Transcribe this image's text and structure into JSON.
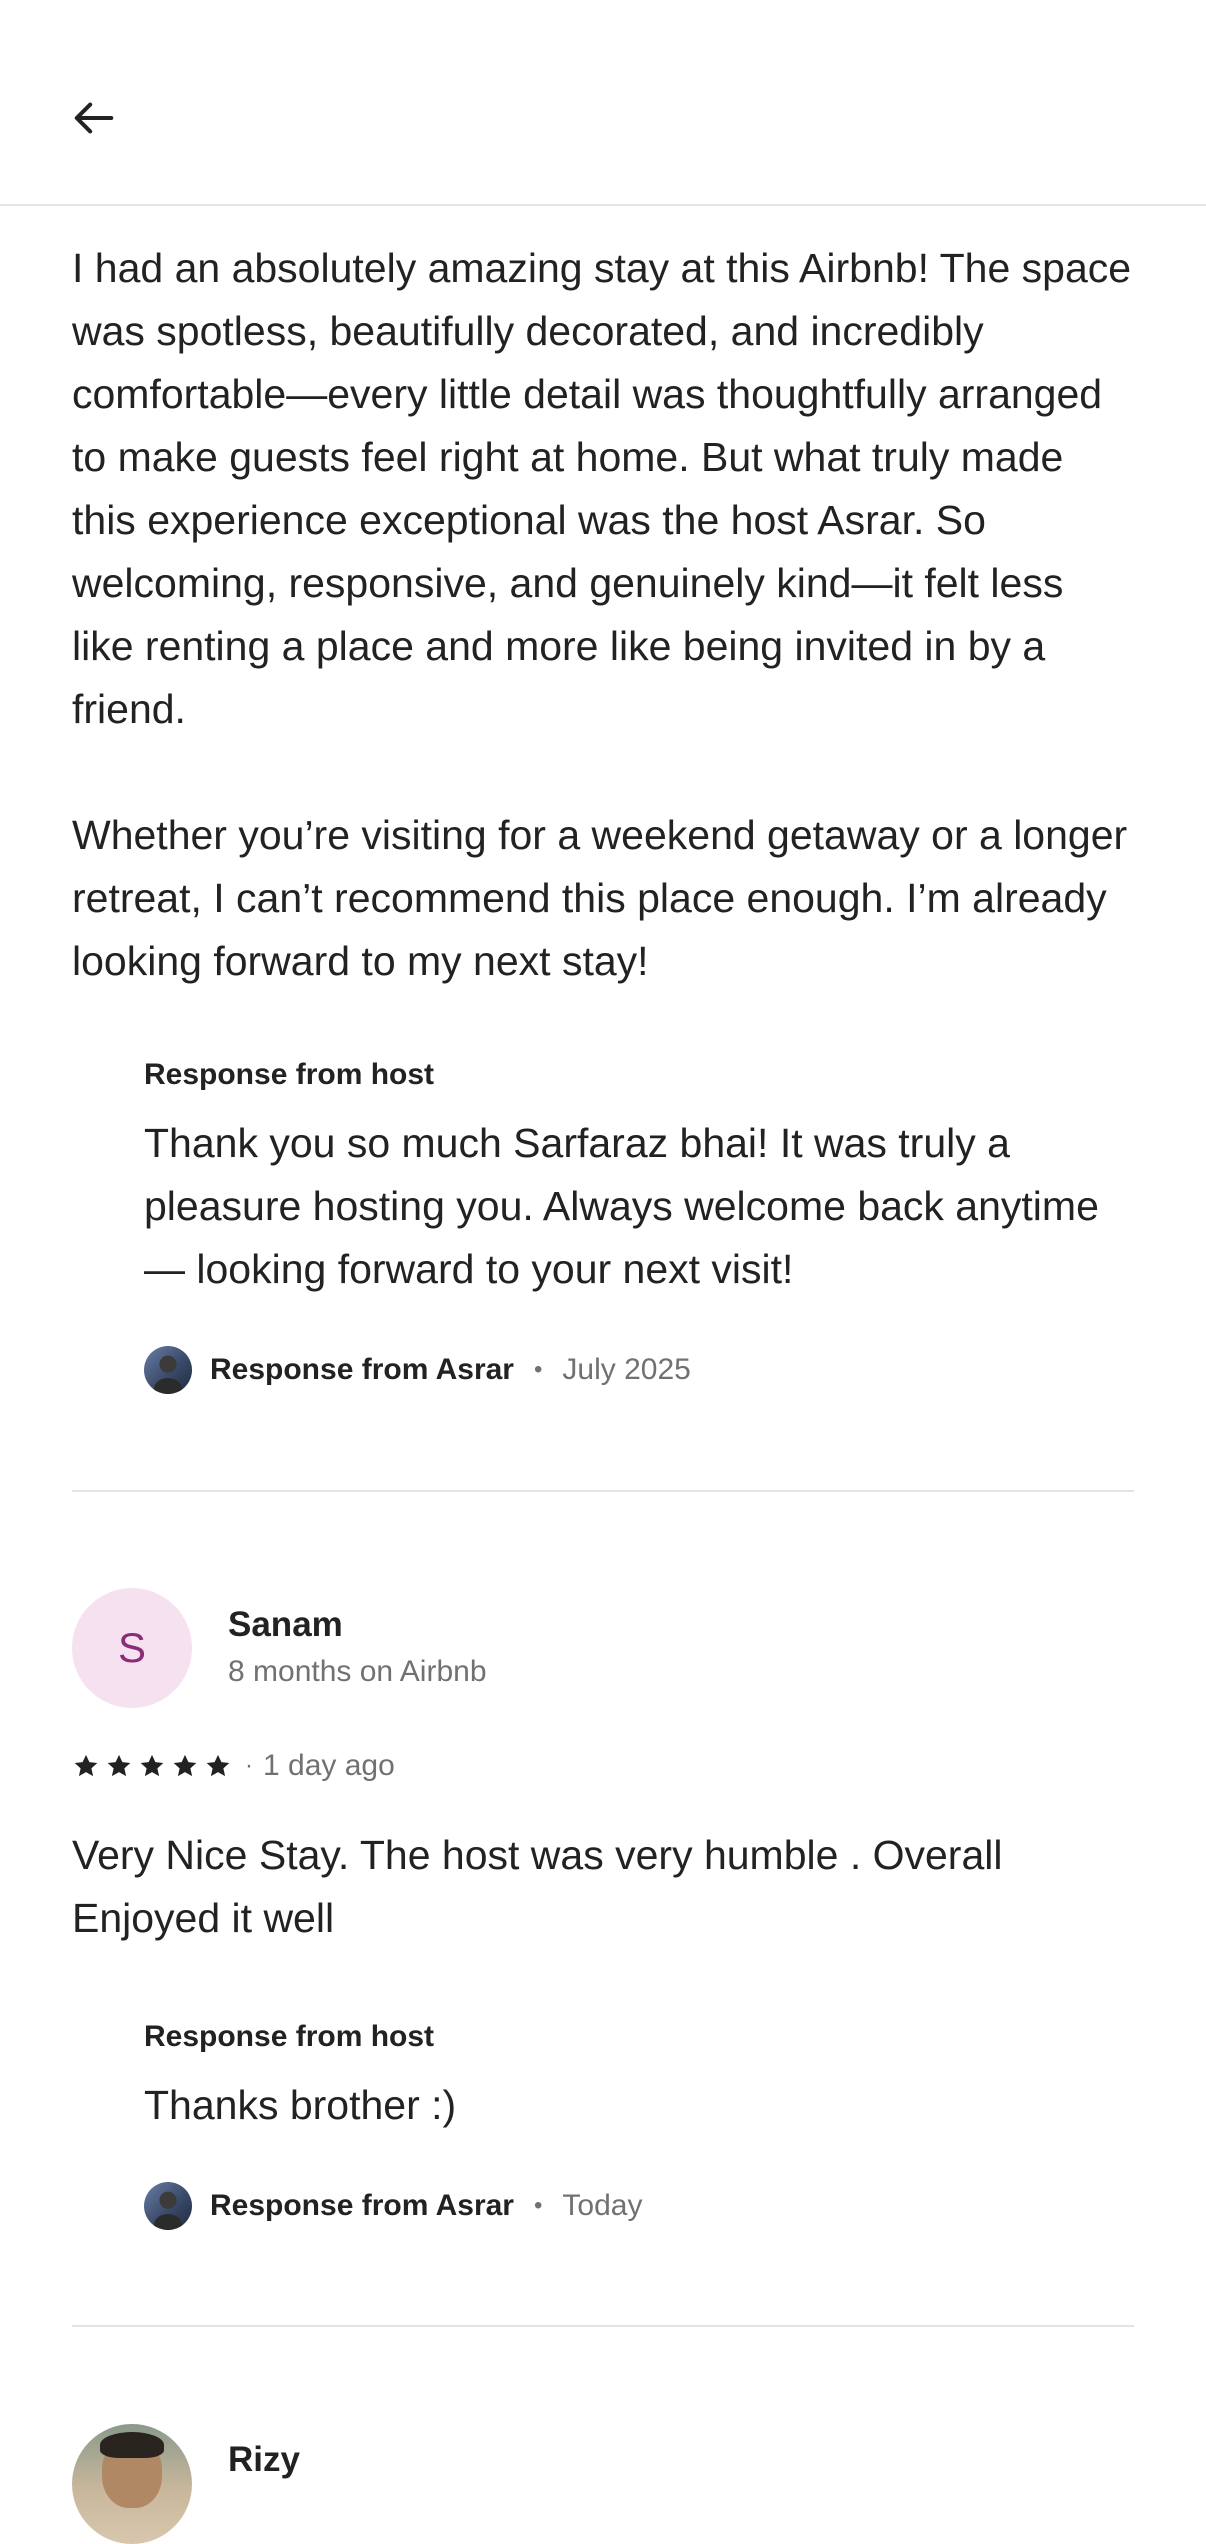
{
  "header": {
    "back_icon": "arrow-left-icon"
  },
  "review1": {
    "paragraph1": "I had an absolutely amazing stay at this Airbnb! The space was spotless, beautifully decorated, and incredibly comfortable—every little detail was thoughtfully arranged to make guests feel right at home. But what truly made this experience exceptional was the host Asrar. So welcoming, responsive, and genuinely kind—it felt less like renting a place and more like being invited in by a friend.",
    "paragraph2": "Whether you’re visiting for a weekend getaway or a longer retreat, I can’t recommend this place enough. I’m already looking forward to my next stay!",
    "response": {
      "label": "Response from host",
      "text": "Thank you so much Sarfaraz bhai! It was truly a pleasure hosting you. Always welcome back anytime — looking forward to your next visit!",
      "author": "Response from Asrar",
      "separator": "•",
      "date": "July 2025"
    }
  },
  "review2": {
    "initial": "S",
    "name": "Sanam",
    "tenure": "8 months on Airbnb",
    "rating": 5,
    "separator": "·",
    "date": "1 day ago",
    "text": "Very Nice Stay. The host was very humble . Overall Enjoyed it well",
    "response": {
      "label": "Response from host",
      "text": "Thanks brother :)",
      "author": "Response from Asrar",
      "separator": "•",
      "date": "Today"
    }
  },
  "review3": {
    "name": "Rizy"
  },
  "colors": {
    "text": "#222222",
    "muted": "#717171",
    "divider": "#e4e4e4",
    "avatar_bg": "#f6e1f0",
    "avatar_fg": "#8a2d76"
  }
}
